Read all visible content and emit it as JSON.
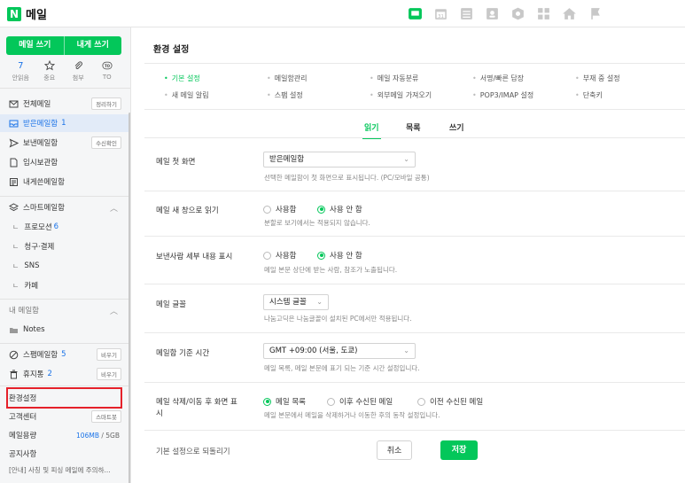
{
  "app": {
    "logo_letter": "N",
    "name": "메일",
    "brand_color": "#03c75a"
  },
  "top_apps": [
    "mail-app-icon",
    "calendar-icon",
    "memo-icon",
    "contacts-icon",
    "mybox-icon",
    "office-icon",
    "home-icon",
    "bookmark-icon"
  ],
  "sidebar": {
    "write_mail": "메일 쓰기",
    "write_self": "내게 쓰기",
    "quick": [
      {
        "value": "7",
        "label": "안읽음"
      },
      {
        "value": "",
        "label": "중요"
      },
      {
        "value": "",
        "label": "첨부"
      },
      {
        "value": "",
        "label": "TO"
      }
    ],
    "folders": [
      {
        "label": "전체메일",
        "count": "",
        "action": "정리하기"
      },
      {
        "label": "받은메일함",
        "count": "1",
        "action": ""
      },
      {
        "label": "보낸메일함",
        "count": "",
        "action": "수신확인"
      },
      {
        "label": "임시보관함",
        "count": "",
        "action": ""
      },
      {
        "label": "내게쓴메일함",
        "count": "",
        "action": ""
      }
    ],
    "smart_title": "스마트메일함",
    "smart_items": [
      {
        "label": "프로모션",
        "count": "6"
      },
      {
        "label": "청구·결제",
        "count": ""
      },
      {
        "label": "SNS",
        "count": ""
      },
      {
        "label": "카페",
        "count": ""
      }
    ],
    "my_title": "내 메일함",
    "notes": "Notes",
    "spam": {
      "label": "스팸메일함",
      "count": "5",
      "action": "비우기"
    },
    "trash": {
      "label": "휴지통",
      "count": "2",
      "action": "비우기"
    },
    "settings": "환경설정",
    "support": {
      "label": "고객센터",
      "action": "스마트봇"
    },
    "usage": {
      "label": "메일용량",
      "used": "106MB",
      "total": "/ 5GB"
    },
    "notice": "공지사항",
    "notice_text": "[안내] 사칭 및 피싱 메일에 주의하..."
  },
  "main": {
    "title": "환경 설정",
    "tabs": [
      {
        "label": "기본 설정",
        "active": true
      },
      {
        "label": "메일함관리",
        "active": false
      },
      {
        "label": "메일 자동분류",
        "active": false
      },
      {
        "label": "서명/빠른 답장",
        "active": false
      },
      {
        "label": "부재 중 설정",
        "active": false
      },
      {
        "label": "새 메일 알림",
        "active": false
      },
      {
        "label": "스팸 설정",
        "active": false
      },
      {
        "label": "외부메일 가져오기",
        "active": false
      },
      {
        "label": "POP3/IMAP 설정",
        "active": false
      },
      {
        "label": "단축키",
        "active": false
      }
    ],
    "subtabs": [
      {
        "label": "읽기",
        "active": true
      },
      {
        "label": "목록",
        "active": false
      },
      {
        "label": "쓰기",
        "active": false
      }
    ],
    "rows": [
      {
        "label": "메일 첫 화면",
        "select": "받은메일함",
        "desc": "선택한 메일함이 첫 화면으로 표시됩니다. (PC/모바일 공통)"
      },
      {
        "label": "메일 새 창으로 읽기",
        "options": [
          "사용함",
          "사용 안 함"
        ],
        "selected": 1,
        "desc": "분할로 보기에서는 적용되지 않습니다."
      },
      {
        "label": "보낸사람 세부 내용 표시",
        "options": [
          "사용함",
          "사용 안 함"
        ],
        "selected": 1,
        "desc": "메일 본문 상단에 받는 사람, 참조가 노출됩니다."
      },
      {
        "label": "메일 글꼴",
        "select": "시스템 글꼴",
        "desc": "나눔고딕은 나눔글꼴이 설치된 PC에서만 적용됩니다."
      },
      {
        "label": "메일함 기준 시간",
        "select": "GMT +09:00 (서울, 도쿄)",
        "desc": "메일 목록, 메일 본문에 표기 되는 기준 시간 설정입니다."
      },
      {
        "label1": "메일 삭제/이동 후 화면 표",
        "label2": "시",
        "options": [
          "메일 목록",
          "이후 수신된 메일",
          "이전 수신된 메일"
        ],
        "selected": 0,
        "desc": "메일 본문에서 메일을 삭제하거나 이동한 후의 동작 설정입니다."
      }
    ],
    "reset": "기본 설정으로 되돌리기",
    "cancel": "취소",
    "save": "저장"
  }
}
